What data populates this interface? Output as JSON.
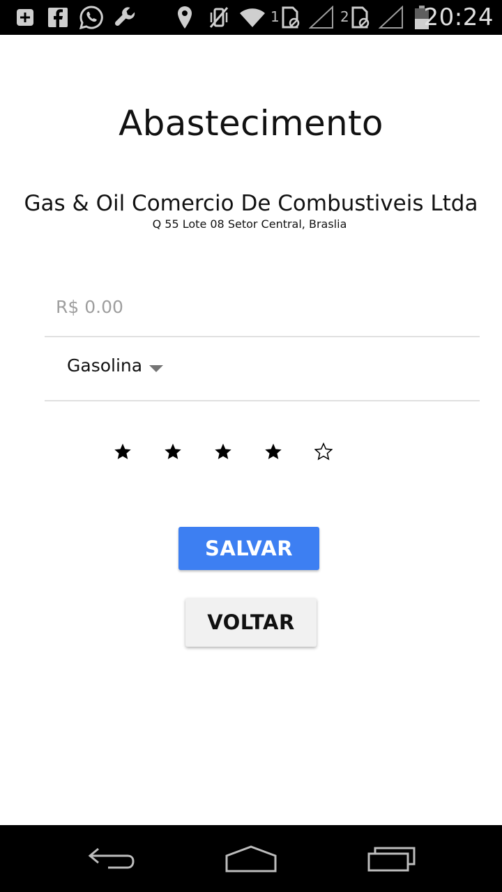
{
  "status_bar": {
    "time": "20:24",
    "sim1_label": "1",
    "sim2_label": "2",
    "icons": [
      "add-box-icon",
      "facebook-icon",
      "whatsapp-icon",
      "wrench-icon",
      "location-pin-icon",
      "vibrate-off-icon",
      "wifi-icon",
      "sim-card-icon",
      "signal-icon",
      "battery-icon"
    ]
  },
  "header": {
    "title": "Abastecimento"
  },
  "station": {
    "name": "Gas & Oil Comercio De Combustiveis Ltda",
    "address": "Q 55 Lote 08 Setor Central, Braslia"
  },
  "form": {
    "price_placeholder": "R$ 0.00",
    "price_value": "",
    "fuel_selected": "Gasolina",
    "rating_value": 4,
    "rating_max": 5,
    "filled_star": "★",
    "empty_star": "☆"
  },
  "buttons": {
    "save_label": "SALVAR",
    "back_label": "VOLTAR",
    "save_color": "#3d7ff2"
  },
  "nav_bar": {
    "icons": [
      "back-icon",
      "home-icon",
      "recents-icon"
    ]
  }
}
